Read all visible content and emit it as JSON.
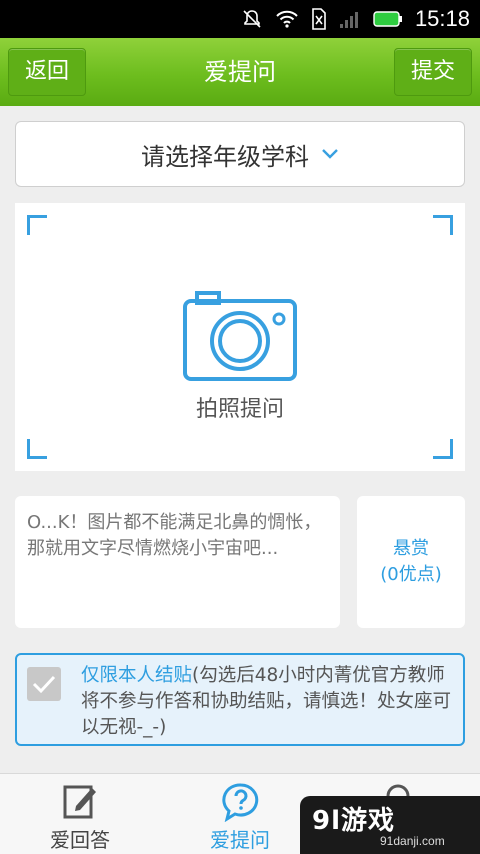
{
  "status_bar": {
    "time": "15:18",
    "icons": [
      "bell-off-icon",
      "wifi-icon",
      "no-sim-icon",
      "signal-icon",
      "battery-icon"
    ],
    "colors": {
      "background": "#000000",
      "battery": "#2ecc40"
    }
  },
  "header": {
    "back_label": "返回",
    "title": "爱提问",
    "submit_label": "提交",
    "accent": "#6dbd1e"
  },
  "subject_select": {
    "label": "请选择年级学科",
    "icon": "chevron-down-icon"
  },
  "photo_area": {
    "label": "拍照提问",
    "icon": "camera-icon",
    "accent": "#38a0e0"
  },
  "question": {
    "text": "O...K！图片都不能满足北鼻的惆怅，那就用文字尽情燃烧小宇宙吧..."
  },
  "reward": {
    "label": "悬赏",
    "value": "(0优点)"
  },
  "notice": {
    "checked": true,
    "highlight": "仅限本人结贴",
    "text": "(勾选后48小时内菁优官方教师将不参与作答和协助结贴，请慎选！处女座可以无视-_-)"
  },
  "tabs": [
    {
      "label": "爱回答",
      "icon": "pencil-note-icon",
      "active": false
    },
    {
      "label": "爱提问",
      "icon": "question-bubble-icon",
      "active": true
    },
    {
      "label": "",
      "icon": "search-icon",
      "active": false
    }
  ],
  "watermark": {
    "logo": "9l游戏",
    "url": "91danji.com"
  }
}
